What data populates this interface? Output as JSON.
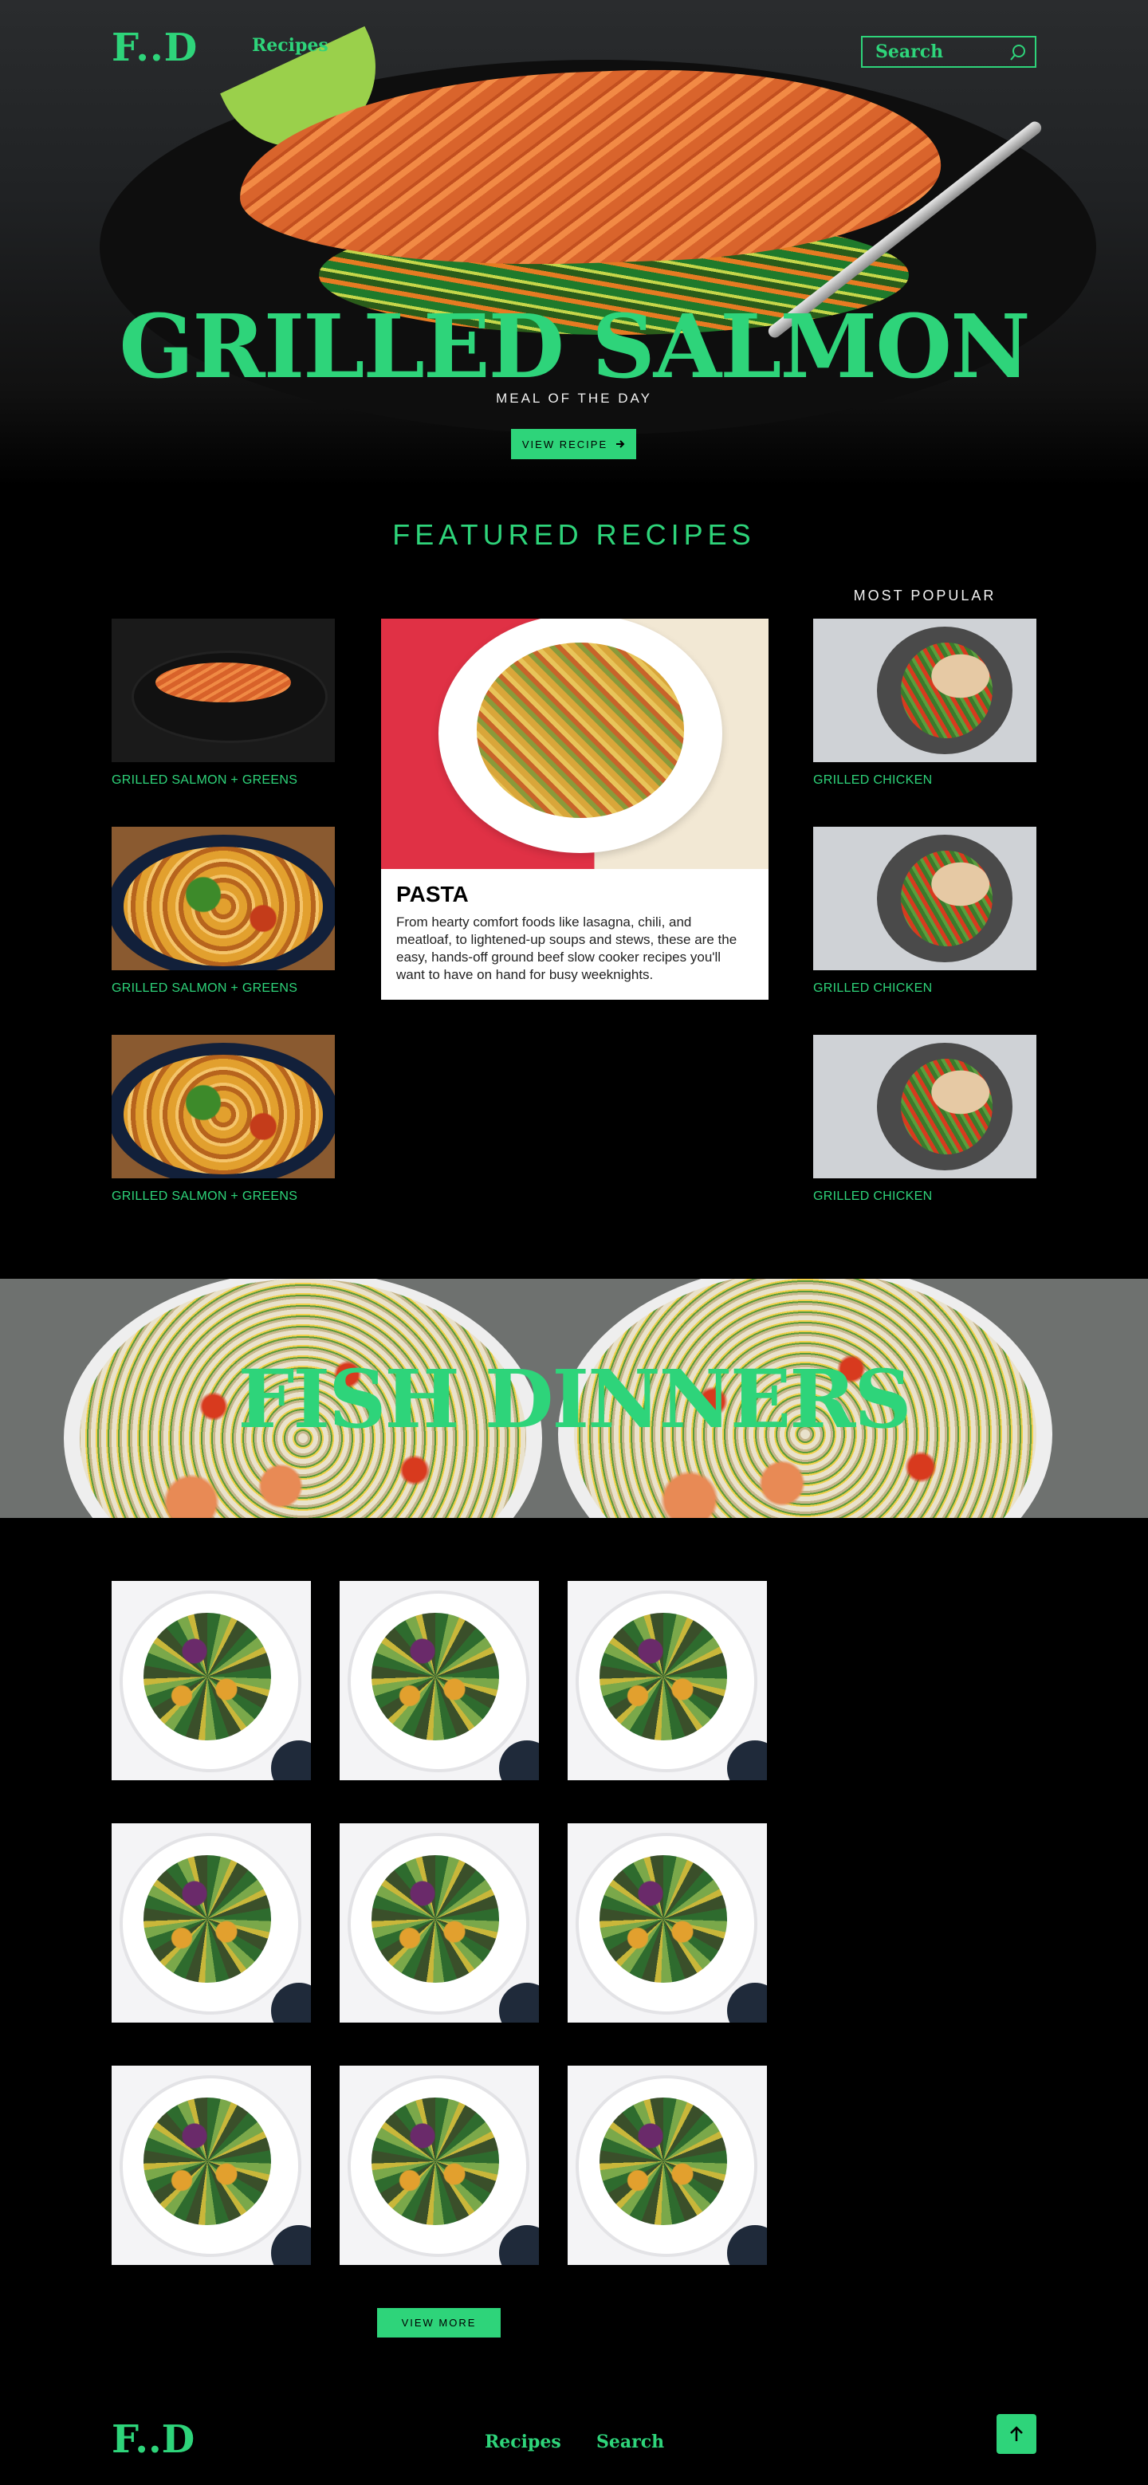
{
  "nav": {
    "logo": "F..D",
    "links": [
      "Recipes"
    ],
    "search_placeholder": "Search"
  },
  "hero": {
    "title": "GRILLED SALMON",
    "subtitle": "MEAL OF THE DAY",
    "button": "VIEW RECIPE",
    "button_icon": "arrow-right-icon"
  },
  "featured": {
    "title": "FEATURED RECIPES",
    "popular_title": "MOST POPULAR",
    "left_cards": [
      "GRILLED SALMON + GREENS",
      "GRILLED SALMON + GREENS",
      "GRILLED SALMON + GREENS"
    ],
    "right_cards": [
      "GRILLED CHICKEN",
      "GRILLED CHICKEN",
      "GRILLED CHICKEN"
    ],
    "main": {
      "title": "PASTA",
      "text": "From hearty comfort foods like lasagna, chili, and meatloaf, to lightened-up soups and stews, these are the easy, hands-off ground beef slow cooker recipes you'll want to have on hand for busy weeknights."
    }
  },
  "fish": {
    "title": "FISH DINNERS",
    "button": "VIEW MORE"
  },
  "footer": {
    "logo": "F..D",
    "links": [
      "Recipes",
      "Search"
    ],
    "top_icon": "arrow-up-icon"
  },
  "colors": {
    "accent": "#2ed47a",
    "background": "#000000"
  }
}
